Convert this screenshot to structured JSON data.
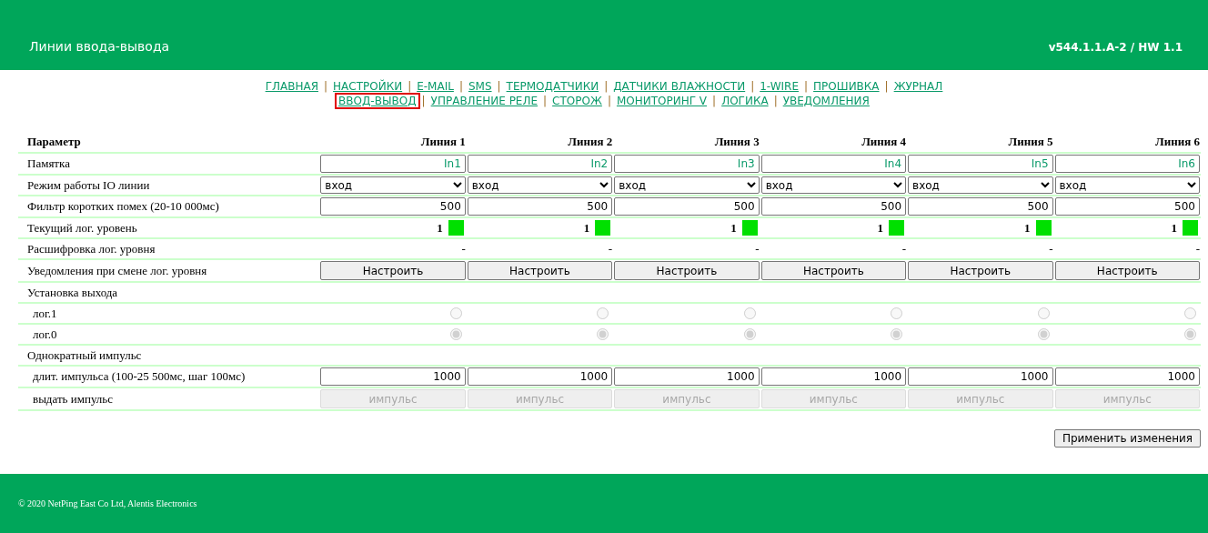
{
  "header": {
    "title": "Линии ввода-вывода",
    "version": "v544.1.1.A-2 / HW 1.1"
  },
  "nav": [
    [
      {
        "label": "ГЛАВНАЯ",
        "selected": false,
        "separator": "|"
      },
      {
        "label": "НАСТРОЙКИ",
        "selected": false,
        "separator": "|"
      },
      {
        "label": "E-MAIL",
        "selected": false,
        "separator": "|"
      },
      {
        "label": "SMS",
        "selected": false,
        "separator": "|"
      },
      {
        "label": "ТЕРМОДАТЧИКИ",
        "selected": false,
        "separator": "|"
      },
      {
        "label": "ДАТЧИКИ ВЛАЖНОСТИ",
        "selected": false,
        "separator": "|"
      },
      {
        "label": "1-WIRE",
        "selected": false,
        "separator": "|"
      },
      {
        "label": "ПРОШИВКА",
        "selected": false,
        "separator": "|"
      },
      {
        "label": "ЖУРНАЛ",
        "selected": false
      }
    ],
    [
      {
        "label": "ВВОД-ВЫВОД",
        "selected": true,
        "separator": "|"
      },
      {
        "label": "УПРАВЛЕНИЕ РЕЛЕ",
        "selected": false,
        "separator": "|"
      },
      {
        "label": "СТОРОЖ",
        "selected": false,
        "separator": "|"
      },
      {
        "label": "МОНИТОРИНГ V",
        "selected": false,
        "separator": "|"
      },
      {
        "label": "ЛОГИКА",
        "selected": false,
        "separator": "|"
      },
      {
        "label": "УВЕДОМЛЕНИЯ",
        "selected": false
      }
    ]
  ],
  "table": {
    "columns": [
      "Параметр",
      "Линия 1",
      "Линия 2",
      "Линия 3",
      "Линия 4",
      "Линия 5",
      "Линия 6"
    ],
    "rows": [
      {
        "kind": "text-input",
        "label": "Памятка",
        "cells": [
          {
            "value": "In1"
          },
          {
            "value": "In2"
          },
          {
            "value": "In3"
          },
          {
            "value": "In4"
          },
          {
            "value": "In5"
          },
          {
            "value": "In6"
          }
        ]
      },
      {
        "kind": "select",
        "label": "Режим работы IO линии",
        "cells": [
          {
            "value": "вход"
          },
          {
            "value": "вход"
          },
          {
            "value": "вход"
          },
          {
            "value": "вход"
          },
          {
            "value": "вход"
          },
          {
            "value": "вход"
          }
        ]
      },
      {
        "kind": "number-input",
        "label": "Фильтр коротких помех (20-10 000мс)",
        "cells": [
          {
            "value": "500"
          },
          {
            "value": "500"
          },
          {
            "value": "500"
          },
          {
            "value": "500"
          },
          {
            "value": "500"
          },
          {
            "value": "500"
          }
        ]
      },
      {
        "kind": "level",
        "label": "Текущий лог. уровень",
        "cells": [
          {
            "value": "1",
            "on": true
          },
          {
            "value": "1",
            "on": true
          },
          {
            "value": "1",
            "on": true
          },
          {
            "value": "1",
            "on": true
          },
          {
            "value": "1",
            "on": true
          },
          {
            "value": "1",
            "on": true
          }
        ]
      },
      {
        "kind": "text",
        "label": "Расшифровка лог. уровня",
        "cells": [
          {
            "value": "-"
          },
          {
            "value": "-"
          },
          {
            "value": "-"
          },
          {
            "value": "-"
          },
          {
            "value": "-"
          },
          {
            "value": "-"
          }
        ]
      },
      {
        "kind": "button",
        "label": "Уведомления при смене лог. уровня",
        "cells": [
          {
            "value": "Настроить",
            "disabled": false
          },
          {
            "value": "Настроить",
            "disabled": false
          },
          {
            "value": "Настроить",
            "disabled": false
          },
          {
            "value": "Настроить",
            "disabled": false
          },
          {
            "value": "Настроить",
            "disabled": false
          },
          {
            "value": "Настроить",
            "disabled": false
          }
        ]
      },
      {
        "kind": "section",
        "label": "Установка выхода",
        "children": [
          {
            "kind": "radio",
            "label": "лог.1",
            "cells": [
              {
                "checked": false,
                "disabled": true
              },
              {
                "checked": false,
                "disabled": true
              },
              {
                "checked": false,
                "disabled": true
              },
              {
                "checked": false,
                "disabled": true
              },
              {
                "checked": false,
                "disabled": true
              },
              {
                "checked": false,
                "disabled": true
              }
            ]
          },
          {
            "kind": "radio",
            "label": "лог.0",
            "cells": [
              {
                "checked": true,
                "disabled": true
              },
              {
                "checked": true,
                "disabled": true
              },
              {
                "checked": true,
                "disabled": true
              },
              {
                "checked": true,
                "disabled": true
              },
              {
                "checked": true,
                "disabled": true
              },
              {
                "checked": true,
                "disabled": true
              }
            ]
          }
        ]
      },
      {
        "kind": "section",
        "label": "Однократный импульс",
        "children": [
          {
            "kind": "number-input",
            "label": "длит. импульса (100-25 500мс, шаг 100мс)",
            "cells": [
              {
                "value": "1000"
              },
              {
                "value": "1000"
              },
              {
                "value": "1000"
              },
              {
                "value": "1000"
              },
              {
                "value": "1000"
              },
              {
                "value": "1000"
              }
            ]
          },
          {
            "kind": "button",
            "label": "выдать импульс",
            "cells": [
              {
                "value": "импульс",
                "disabled": true
              },
              {
                "value": "импульс",
                "disabled": true
              },
              {
                "value": "импульс",
                "disabled": true
              },
              {
                "value": "импульс",
                "disabled": true
              },
              {
                "value": "импульс",
                "disabled": true
              },
              {
                "value": "импульс",
                "disabled": true
              }
            ]
          }
        ]
      }
    ]
  },
  "apply_button": "Применить изменения",
  "footer": "© 2020 NetPing East Co Ltd, Alentis Electronics"
}
